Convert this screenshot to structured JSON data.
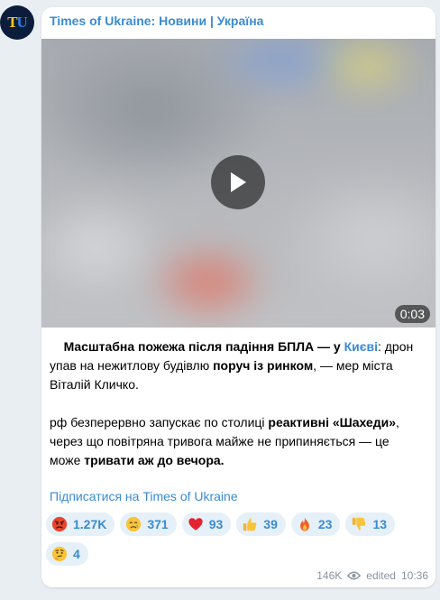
{
  "channel": {
    "name": "Times of Ukraine: Новини | Україна",
    "avatar_letters": [
      "T",
      "U"
    ]
  },
  "video": {
    "duration": "0:03"
  },
  "post": {
    "p1": {
      "a": "Масштабна пожежа після падіння БПЛА — у ",
      "b": "Києві",
      "c": ": дрон упав на нежитлову будівлю ",
      "d": "поруч із ринком",
      "e": ", — мер міста Віталій Кличко."
    },
    "p2": {
      "a": "рф безперервно запускає по столиці ",
      "b": "реактивні «Шахеди»",
      "c": ", через що повітряна тривога майже не припиняється — це може ",
      "d": "тривати аж до вечора."
    },
    "subscribe_link": "Підписатися на Times of Ukraine"
  },
  "reactions": [
    {
      "emoji": "angry-face",
      "count": "1.27K"
    },
    {
      "emoji": "crying-face",
      "count": "371"
    },
    {
      "emoji": "red-heart",
      "count": "93"
    },
    {
      "emoji": "thumbs-up",
      "count": "39"
    },
    {
      "emoji": "fire",
      "count": "23"
    },
    {
      "emoji": "thumbs-down",
      "count": "13"
    },
    {
      "emoji": "thinking-face",
      "count": "4"
    }
  ],
  "meta": {
    "views": "146K",
    "edited_label": "edited",
    "time": "10:36"
  },
  "colors": {
    "background": "#e9eef2",
    "accent": "#3a8bd1",
    "reaction_bg": "#e6f0f8",
    "avatar_bg": "#0b1d3a"
  }
}
